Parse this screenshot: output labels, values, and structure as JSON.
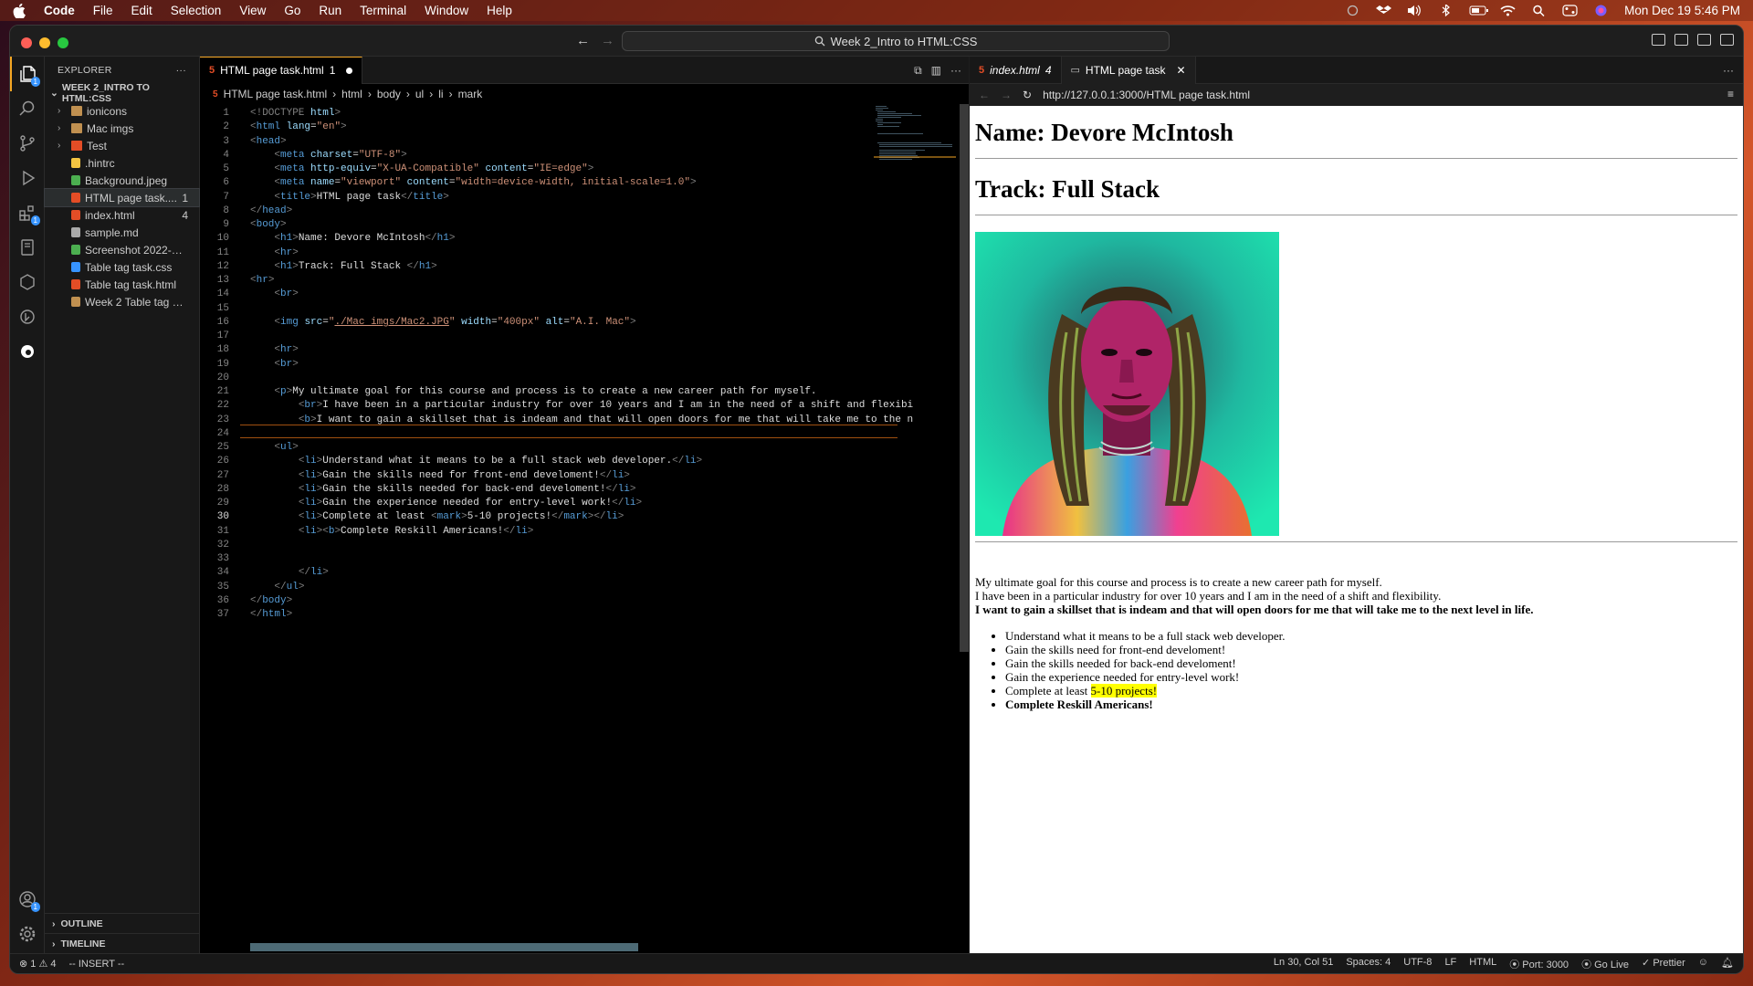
{
  "menubar": {
    "app": "Code",
    "items": [
      "File",
      "Edit",
      "Selection",
      "View",
      "Go",
      "Run",
      "Terminal",
      "Window",
      "Help"
    ],
    "datetime": "Mon Dec 19  5:46 PM"
  },
  "titlebar": {
    "search_text": "Week 2_Intro to HTML:CSS"
  },
  "explorer": {
    "header": "EXPLORER",
    "more": "···",
    "folder": "WEEK 2_INTRO TO HTML:CSS",
    "items": [
      {
        "label": "ionicons",
        "type": "folder",
        "count": ""
      },
      {
        "label": "Mac imgs",
        "type": "folder",
        "count": ""
      },
      {
        "label": "Test",
        "type": "folder",
        "count": ""
      },
      {
        "label": ".hintrc",
        "type": "json",
        "count": ""
      },
      {
        "label": "Background.jpeg",
        "type": "image",
        "count": ""
      },
      {
        "label": "HTML page task....",
        "type": "html",
        "count": "1"
      },
      {
        "label": "index.html",
        "type": "html",
        "count": "4"
      },
      {
        "label": "sample.md",
        "type": "md",
        "count": ""
      },
      {
        "label": "Screenshot 2022-12-...",
        "type": "image",
        "count": ""
      },
      {
        "label": "Table tag task.css",
        "type": "css",
        "count": ""
      },
      {
        "label": "Table tag task.html",
        "type": "html",
        "count": ""
      },
      {
        "label": "Week 2 Table tag tas...",
        "type": "file",
        "count": ""
      }
    ],
    "outline": "OUTLINE",
    "timeline": "TIMELINE"
  },
  "editor": {
    "tab_label": "HTML page task.html",
    "tab_count": "1",
    "breadcrumbs": [
      "HTML page task.html",
      "html",
      "body",
      "ul",
      "li",
      "mark"
    ],
    "lines": [
      {
        "n": "1",
        "html": "<span class='g'>&lt;!DOCTYPE</span> <span class='a'>html</span><span class='g'>&gt;</span>"
      },
      {
        "n": "2",
        "html": "<span class='g'>&lt;</span><span class='t'>html</span> <span class='a'>lang</span>=<span class='s'>\"en\"</span><span class='g'>&gt;</span>"
      },
      {
        "n": "3",
        "html": "<span class='g'>&lt;</span><span class='t'>head</span><span class='g'>&gt;</span>"
      },
      {
        "n": "4",
        "html": "    <span class='g'>&lt;</span><span class='t'>meta</span> <span class='a'>charset</span>=<span class='s'>\"UTF-8\"</span><span class='g'>&gt;</span>"
      },
      {
        "n": "5",
        "html": "    <span class='g'>&lt;</span><span class='t'>meta</span> <span class='a'>http-equiv</span>=<span class='s'>\"X-UA-Compatible\"</span> <span class='a'>content</span>=<span class='s'>\"IE=edge\"</span><span class='g'>&gt;</span>"
      },
      {
        "n": "6",
        "html": "    <span class='g'>&lt;</span><span class='t'>meta</span> <span class='a'>name</span>=<span class='s'>\"viewport\"</span> <span class='a'>content</span>=<span class='s'>\"width=device-width, initial-scale=1.0\"</span><span class='g'>&gt;</span>"
      },
      {
        "n": "7",
        "html": "    <span class='g'>&lt;</span><span class='t'>title</span><span class='g'>&gt;</span>HTML page task<span class='g'>&lt;/</span><span class='t'>title</span><span class='g'>&gt;</span>"
      },
      {
        "n": "8",
        "html": "<span class='g'>&lt;/</span><span class='t'>head</span><span class='g'>&gt;</span>"
      },
      {
        "n": "9",
        "html": "<span class='g'>&lt;</span><span class='t'>body</span><span class='g'>&gt;</span>"
      },
      {
        "n": "10",
        "html": "    <span class='g'>&lt;</span><span class='t'>h1</span><span class='g'>&gt;</span>Name: Devore McIntosh<span class='g'>&lt;/</span><span class='t'>h1</span><span class='g'>&gt;</span>"
      },
      {
        "n": "11",
        "html": "    <span class='g'>&lt;</span><span class='t'>hr</span><span class='g'>&gt;</span>"
      },
      {
        "n": "12",
        "html": "    <span class='g'>&lt;</span><span class='t'>h1</span><span class='g'>&gt;</span>Track: Full Stack <span class='g'>&lt;/</span><span class='t'>h1</span><span class='g'>&gt;</span>"
      },
      {
        "n": "13",
        "html": "<span class='g'>&lt;</span><span class='t'>hr</span><span class='g'>&gt;</span>"
      },
      {
        "n": "14",
        "html": "    <span class='g'>&lt;</span><span class='t'>br</span><span class='g'>&gt;</span>"
      },
      {
        "n": "15",
        "html": ""
      },
      {
        "n": "16",
        "html": "    <span class='g'>&lt;</span><span class='t'>img</span> <span class='a'>src</span>=<span class='s'>\"<u>./Mac imgs/Mac2.JPG</u>\"</span> <span class='a'>width</span>=<span class='s'>\"400px\"</span> <span class='a'>alt</span>=<span class='s'>\"A.I. Mac\"</span><span class='g'>&gt;</span>"
      },
      {
        "n": "17",
        "html": ""
      },
      {
        "n": "18",
        "html": "    <span class='g'>&lt;</span><span class='t'>hr</span><span class='g'>&gt;</span>"
      },
      {
        "n": "19",
        "html": "    <span class='g'>&lt;</span><span class='t'>br</span><span class='g'>&gt;</span>"
      },
      {
        "n": "20",
        "html": ""
      },
      {
        "n": "21",
        "html": "    <span class='g'>&lt;</span><span class='t'>p</span><span class='g'>&gt;</span>My ultimate goal for this course and process is to create a new career path for myself."
      },
      {
        "n": "22",
        "html": "        <span class='g'>&lt;</span><span class='t'>br</span><span class='g'>&gt;</span>I have been in a particular industry for over 10 years and I am in the need of a shift and flexibi"
      },
      {
        "n": "23",
        "html": "        <span class='g'>&lt;</span><span class='t'>b</span><span class='g'>&gt;</span>I want to gain a skillset that is indeam and that will open doors for me that will take me to the n"
      },
      {
        "n": "24",
        "html": ""
      },
      {
        "n": "25",
        "html": "    <span class='g'>&lt;</span><span class='t'>ul</span><span class='g'>&gt;</span>"
      },
      {
        "n": "26",
        "html": "        <span class='g'>&lt;</span><span class='t'>li</span><span class='g'>&gt;</span>Understand what it means to be a full stack web developer.<span class='g'>&lt;/</span><span class='t'>li</span><span class='g'>&gt;</span>"
      },
      {
        "n": "27",
        "html": "        <span class='g'>&lt;</span><span class='t'>li</span><span class='g'>&gt;</span>Gain the skills need for front-end develoment!<span class='g'>&lt;/</span><span class='t'>li</span><span class='g'>&gt;</span>"
      },
      {
        "n": "28",
        "html": "        <span class='g'>&lt;</span><span class='t'>li</span><span class='g'>&gt;</span>Gain the skills needed for back-end develoment!<span class='g'>&lt;/</span><span class='t'>li</span><span class='g'>&gt;</span>"
      },
      {
        "n": "29",
        "html": "        <span class='g'>&lt;</span><span class='t'>li</span><span class='g'>&gt;</span>Gain the experience needed for entry-level work!<span class='g'>&lt;/</span><span class='t'>li</span><span class='g'>&gt;</span>"
      },
      {
        "n": "30",
        "html": "        <span class='g'>&lt;</span><span class='t'>li</span><span class='g'>&gt;</span>Complete at least <span class='g'>&lt;</span><span class='t'>mark</span><span class='g'>&gt;</span>5-10 projects!<span class='g'>&lt;/</span><span class='t'>mark</span><span class='g'>&gt;&lt;/</span><span class='t'>li</span><span class='g'>&gt;</span>"
      },
      {
        "n": "31",
        "html": "        <span class='g'>&lt;</span><span class='t'>li</span><span class='g'>&gt;&lt;</span><span class='t'>b</span><span class='g'>&gt;</span>Complete Reskill Americans!<span class='g'>&lt;/</span><span class='t'>li</span><span class='g'>&gt;</span>"
      },
      {
        "n": "32",
        "html": ""
      },
      {
        "n": "33",
        "html": ""
      },
      {
        "n": "34",
        "html": "        <span class='g'>&lt;/</span><span class='t'>li</span><span class='g'>&gt;</span>"
      },
      {
        "n": "35",
        "html": "    <span class='g'>&lt;/</span><span class='t'>ul</span><span class='g'>&gt;</span>"
      },
      {
        "n": "36",
        "html": "<span class='g'>&lt;/</span><span class='t'>body</span><span class='g'>&gt;</span>"
      },
      {
        "n": "37",
        "html": "<span class='g'>&lt;/</span><span class='t'>html</span><span class='g'>&gt;</span>"
      }
    ]
  },
  "preview": {
    "tab1_label": "index.html",
    "tab1_count": "4",
    "tab2_label": "HTML page task",
    "url": "http://127.0.0.1:3000/HTML page task.html",
    "heading1": "Name: Devore McIntosh",
    "heading2": "Track: Full Stack",
    "para_line1": "My ultimate goal for this course and process is to create a new career path for myself.",
    "para_line2": "I have been in a particular industry for over 10 years and I am in the need of a shift and flexibility.",
    "para_line3": "I want to gain a skillset that is indeam and that will open doors for me that will take me to the next level in life.",
    "list": [
      "Understand what it means to be a full stack web developer.",
      "Gain the skills need for front-end develoment!",
      "Gain the skills needed for back-end develoment!",
      "Gain the experience needed for entry-level work!"
    ],
    "list_item5_prefix": "Complete at least ",
    "list_item5_mark": "5-10 projects!",
    "list_item6": "Complete Reskill Americans!"
  },
  "statusbar": {
    "problems": "⊗ 1 ⚠ 4",
    "mode": "-- INSERT --",
    "position": "Ln 30, Col 51",
    "spaces": "Spaces: 4",
    "encoding": "UTF-8",
    "eol": "LF",
    "language": "HTML",
    "port": "Port: 3000",
    "golive": "Go Live",
    "prettier": "Prettier"
  },
  "colors": {
    "accent": "#f5a623",
    "html_icon": "#e44d26",
    "css_icon": "#3794ff",
    "mark": "#ffff00"
  }
}
